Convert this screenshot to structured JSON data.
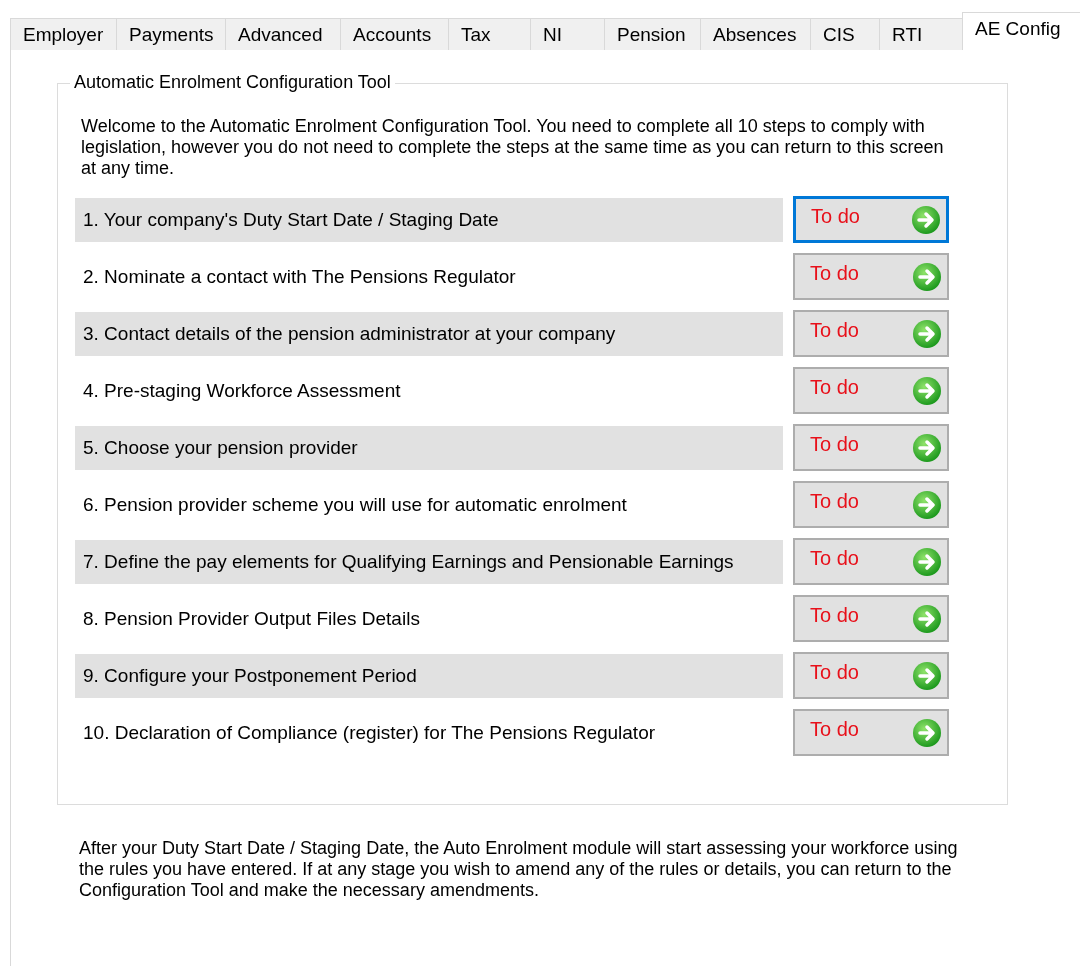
{
  "tabs": [
    {
      "label": "Employer",
      "selected": false
    },
    {
      "label": "Payments",
      "selected": false
    },
    {
      "label": "Advanced",
      "selected": false
    },
    {
      "label": "Accounts",
      "selected": false
    },
    {
      "label": "Tax",
      "selected": false
    },
    {
      "label": "NI",
      "selected": false
    },
    {
      "label": "Pension",
      "selected": false
    },
    {
      "label": "Absences",
      "selected": false
    },
    {
      "label": "CIS",
      "selected": false
    },
    {
      "label": "RTI",
      "selected": false
    },
    {
      "label": "AE Config",
      "selected": true
    }
  ],
  "group": {
    "title": "Automatic Enrolment Configuration Tool",
    "intro": "Welcome to the Automatic Enrolment Configuration Tool.  You need to complete all 10 steps to comply with legislation, however you do not need to complete the steps at the same time as you can return to this screen at any time.",
    "steps": [
      {
        "label": "1. Your company's Duty Start Date / Staging Date",
        "status": "To do",
        "focused": true
      },
      {
        "label": "2. Nominate a contact with The Pensions Regulator",
        "status": "To do",
        "focused": false
      },
      {
        "label": "3. Contact details of the pension administrator at your company",
        "status": "To do",
        "focused": false
      },
      {
        "label": "4. Pre-staging Workforce Assessment",
        "status": "To do",
        "focused": false
      },
      {
        "label": "5. Choose your pension provider",
        "status": "To do",
        "focused": false
      },
      {
        "label": "6. Pension provider scheme you will use for automatic enrolment",
        "status": "To do",
        "focused": false
      },
      {
        "label": "7. Define the pay elements for Qualifying Earnings and Pensionable Earnings",
        "status": "To do",
        "focused": false
      },
      {
        "label": "8. Pension Provider Output Files Details",
        "status": "To do",
        "focused": false
      },
      {
        "label": "9. Configure your Postponement Period",
        "status": "To do",
        "focused": false
      },
      {
        "label": "10. Declaration of Compliance (register) for The Pensions Regulator",
        "status": "To do",
        "focused": false
      }
    ]
  },
  "footer": "After your Duty Start Date / Staging Date, the Auto Enrolment module will start assessing your workforce using the rules you have entered.  If at any stage you wish to amend any of the rules or details, you can return to the Configuration Tool and make the necessary amendments."
}
